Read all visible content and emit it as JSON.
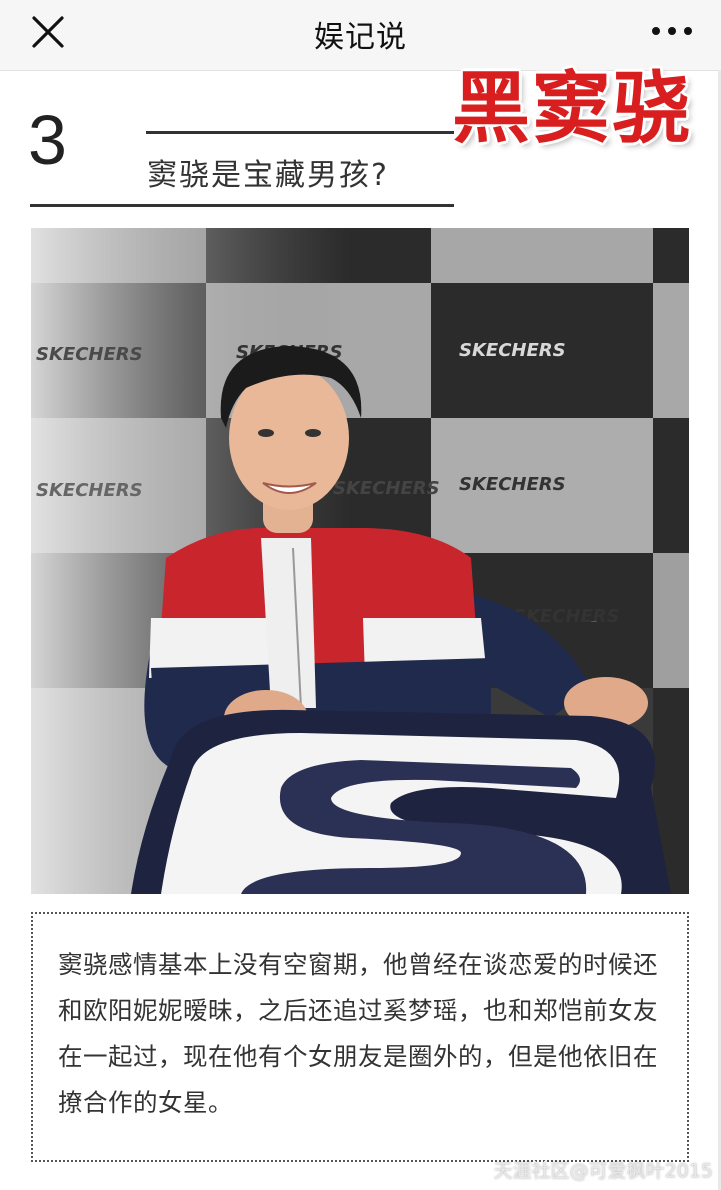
{
  "navbar": {
    "title": "娱记说",
    "close_icon": "close-icon",
    "more_icon": "more-dots-icon"
  },
  "section": {
    "number": "3",
    "title": "窦骁是宝藏男孩?",
    "name_tag": "黑窦骁",
    "name_tag_color": "#d81e1e"
  },
  "photo": {
    "brand_texts": [
      "SKECHERS",
      "SKECHERS",
      "SKECHERS",
      "SKECHERS",
      "SKECHERS",
      "SKECHERS",
      "SKECHERS",
      "SKECHERS"
    ]
  },
  "caption": {
    "text": "窦骁感情基本上没有空窗期，他曾经在谈恋爱的时候还和欧阳妮妮暧昧，之后还追过奚梦瑶，也和郑恺前女友在一起过，现在他有个女朋友是圈外的，但是他依旧在撩合作的女星。"
  },
  "watermark": "天涯社区@可爱枫叶2015"
}
